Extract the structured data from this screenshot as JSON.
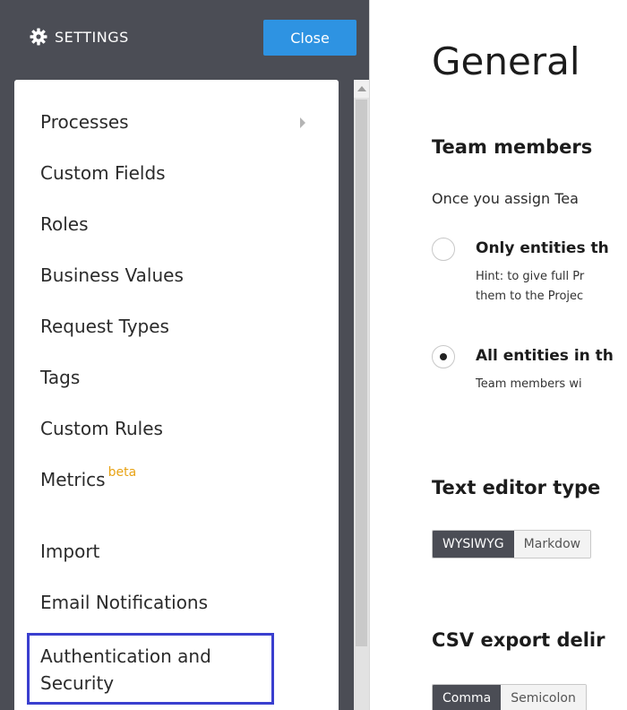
{
  "sidebar": {
    "title": "SETTINGS",
    "close_label": "Close",
    "items": [
      {
        "label": "Processes"
      },
      {
        "label": "Custom Fields"
      },
      {
        "label": "Roles"
      },
      {
        "label": "Business Values"
      },
      {
        "label": "Request Types"
      },
      {
        "label": "Tags"
      },
      {
        "label": "Custom Rules"
      },
      {
        "label": "Metrics",
        "badge": "beta"
      },
      {
        "label": "Import"
      },
      {
        "label": "Email Notifications"
      }
    ],
    "selected_item": {
      "line1": "Authentication and",
      "line2": "Security"
    }
  },
  "main": {
    "page_title": "General",
    "team_members": {
      "heading": "Team members",
      "description": "Once you assign Tea",
      "options": [
        {
          "label": "Only entities th",
          "hint_line1": "Hint: to give full Pr",
          "hint_line2": "them to the Projec",
          "checked": false
        },
        {
          "label": "All entities in th",
          "hint_line1": "Team members wi",
          "checked": true
        }
      ]
    },
    "text_editor": {
      "heading": "Text editor type",
      "options": [
        "WYSIWYG",
        "Markdow"
      ],
      "selected": "WYSIWYG"
    },
    "csv_export": {
      "heading": "CSV export delir",
      "options": [
        "Comma",
        "Semicolon"
      ],
      "selected": "Comma"
    }
  },
  "colors": {
    "sidebar_bg": "#4b4d55",
    "close_button": "#2e93e2",
    "beta_badge": "#e8a316",
    "selection_border": "#3a3fcf"
  },
  "icons": {
    "settings": "gear-icon",
    "submenu": "chevron-right-icon",
    "scroll_up": "scroll-up-arrow-icon"
  }
}
